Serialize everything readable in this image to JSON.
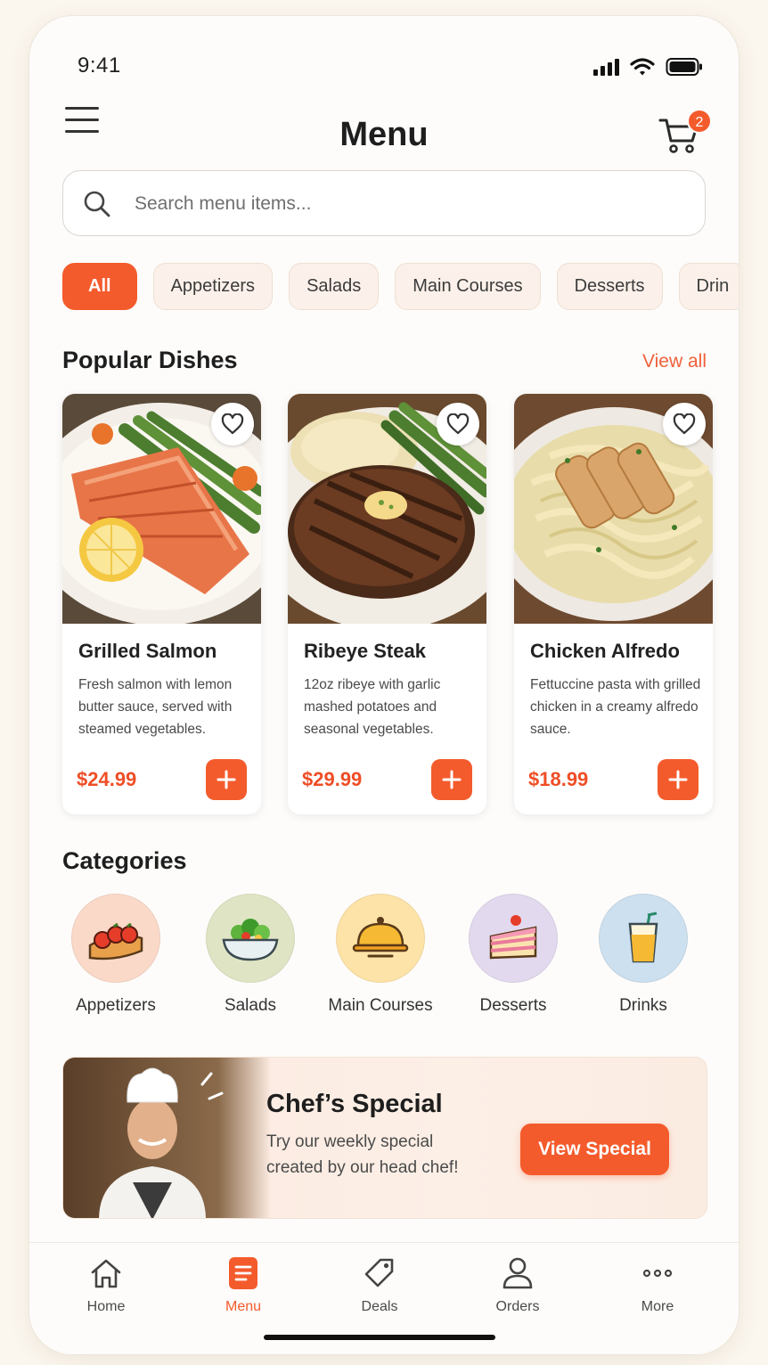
{
  "status_bar": {
    "time": "9:41",
    "icons": [
      "signal-icon",
      "wifi-icon",
      "battery-icon"
    ]
  },
  "header": {
    "title": "Menu",
    "cart_count": "2",
    "menu_icon": "hamburger-icon",
    "cart_icon": "cart-icon"
  },
  "search": {
    "placeholder": "Search menu items...",
    "value": ""
  },
  "categories_filter": {
    "items": [
      "All",
      "Appetizers",
      "Salads",
      "Main Courses",
      "Desserts",
      "Drin"
    ],
    "selected": "All"
  },
  "popular": {
    "title": "Popular Dishes",
    "view_all": "View all",
    "dishes": [
      {
        "name": "Grilled Salmon",
        "description": "Fresh salmon with lemon butter sauce, served with steamed vegetables.",
        "price": "$24.99"
      },
      {
        "name": "Ribeye Steak",
        "description": "12oz ribeye with garlic mashed potatoes and seasonal vegetables.",
        "price": "$29.99"
      },
      {
        "name": "Chicken Alfredo",
        "description": "Fettuccine pasta with grilled chicken in a creamy alfredo sauce.",
        "price": "$18.99"
      }
    ]
  },
  "categories": {
    "title": "Categories",
    "items": [
      {
        "label": "Appetizers",
        "icon": "bruschetta-icon",
        "color": "#fbd9c9"
      },
      {
        "label": "Salads",
        "icon": "salad-bowl-icon",
        "color": "#dfe5c4"
      },
      {
        "label": "Main Courses",
        "icon": "cloche-icon",
        "color": "#fde3a7"
      },
      {
        "label": "Desserts",
        "icon": "cake-slice-icon",
        "color": "#e3d9ee"
      },
      {
        "label": "Drinks",
        "icon": "juice-glass-icon",
        "color": "#cde0ef"
      }
    ]
  },
  "banner": {
    "title": "Chef’s Special",
    "text": "Try our weekly special created by our head chef!",
    "button": "View Special"
  },
  "bottom_nav": {
    "items": [
      {
        "label": "Home",
        "icon": "home-icon"
      },
      {
        "label": "Menu",
        "icon": "menu-list-icon"
      },
      {
        "label": "Deals",
        "icon": "tag-icon"
      },
      {
        "label": "Orders",
        "icon": "user-icon"
      },
      {
        "label": "More",
        "icon": "more-dots-icon"
      }
    ],
    "active": "Menu"
  },
  "colors": {
    "accent": "#f45b2c",
    "price": "#ef4e26",
    "background": "#fbf6ee"
  }
}
